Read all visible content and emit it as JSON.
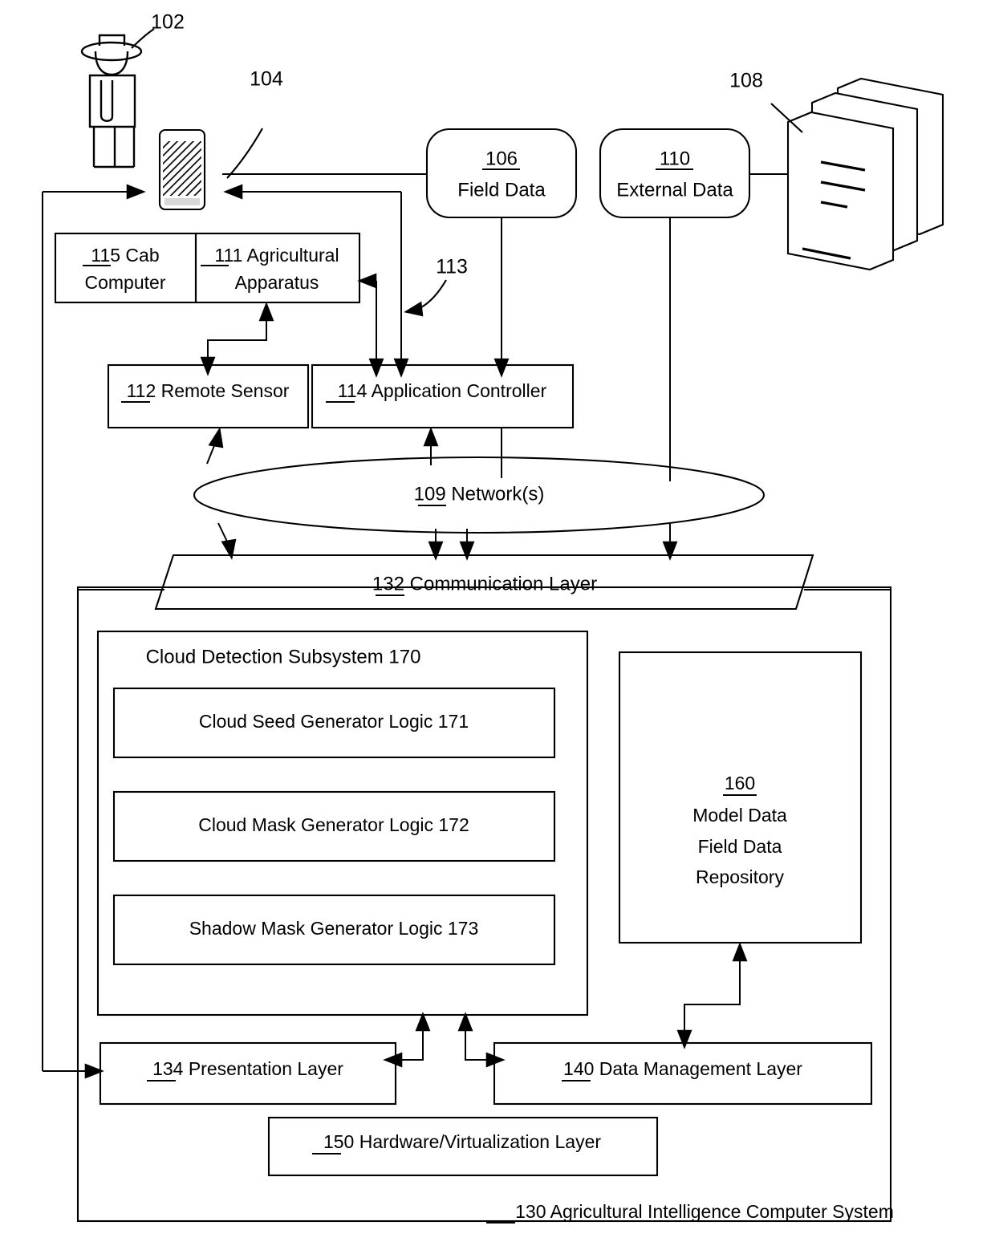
{
  "figure": {
    "title": "Agricultural Intelligence Computer System",
    "type": "patent-block-diagram"
  },
  "reference_labels": {
    "user": "102",
    "mobile_device": "104",
    "servers": "108",
    "apparatus_link": "113"
  },
  "nodes": {
    "field_data": {
      "ref": "106",
      "label": "Field Data"
    },
    "external_data": {
      "ref": "110",
      "label": "External Data"
    },
    "cab_computer": {
      "ref": "115",
      "label_line1": "115 Cab",
      "label_line2": "Computer"
    },
    "agricultural_apparatus": {
      "ref": "111",
      "label_line1": "111 Agricultural",
      "label_line2": "Apparatus"
    },
    "remote_sensor": {
      "ref": "112",
      "label": "112 Remote Sensor"
    },
    "application_controller": {
      "ref": "114",
      "label": "114 Application Controller"
    },
    "network": {
      "ref": "109",
      "label": "109 Network(s)"
    },
    "communication_layer": {
      "ref": "132",
      "label": "132 Communication Layer"
    },
    "cloud_detection_subsystem": {
      "label": "Cloud Detection Subsystem 170"
    },
    "cloud_seed_generator": {
      "label": "Cloud Seed Generator Logic 171"
    },
    "cloud_mask_generator": {
      "label": "Cloud Mask Generator Logic 172"
    },
    "shadow_mask_generator": {
      "label": "Shadow Mask Generator Logic 173"
    },
    "repository": {
      "ref": "160",
      "line1": "160",
      "line2": "Model Data",
      "line3": "Field Data",
      "line4": "Repository"
    },
    "presentation_layer": {
      "ref": "134",
      "label": "134 Presentation Layer"
    },
    "data_management_layer": {
      "ref": "140",
      "label": "140 Data Management Layer"
    },
    "hardware_virtualization_layer": {
      "ref": "150",
      "label": "150 Hardware/Virtualization Layer"
    },
    "agricultural_intelligence_computer_system": {
      "ref": "130",
      "label": "130 Agricultural Intelligence Computer System"
    }
  },
  "colors": {
    "ink": "#000000",
    "paper": "#ffffff"
  }
}
